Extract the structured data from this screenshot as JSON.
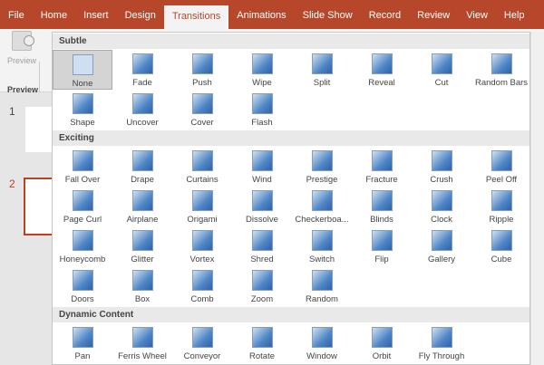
{
  "ribbon": {
    "tabs": [
      "File",
      "Home",
      "Insert",
      "Design",
      "Transitions",
      "Animations",
      "Slide Show",
      "Record",
      "Review",
      "View",
      "Help"
    ],
    "active": "Transitions"
  },
  "toolbar": {
    "preview_label": "Preview",
    "group_label": "Preview"
  },
  "slides": [
    "1",
    "2"
  ],
  "sections": [
    {
      "title": "Subtle",
      "items": [
        "None",
        "Fade",
        "Push",
        "Wipe",
        "Split",
        "Reveal",
        "Cut",
        "Random Bars",
        "Shape",
        "Uncover",
        "Cover",
        "Flash"
      ]
    },
    {
      "title": "Exciting",
      "items": [
        "Fall Over",
        "Drape",
        "Curtains",
        "Wind",
        "Prestige",
        "Fracture",
        "Crush",
        "Peel Off",
        "Page Curl",
        "Airplane",
        "Origami",
        "Dissolve",
        "Checkerboa...",
        "Blinds",
        "Clock",
        "Ripple",
        "Honeycomb",
        "Glitter",
        "Vortex",
        "Shred",
        "Switch",
        "Flip",
        "Gallery",
        "Cube",
        "Doors",
        "Box",
        "Comb",
        "Zoom",
        "Random"
      ]
    },
    {
      "title": "Dynamic Content",
      "items": [
        "Pan",
        "Ferris Wheel",
        "Conveyor",
        "Rotate",
        "Window",
        "Orbit",
        "Fly Through"
      ]
    }
  ],
  "selected": "None",
  "colors": {
    "ribbon": "#b7472a",
    "icon": "#4f86c6"
  }
}
